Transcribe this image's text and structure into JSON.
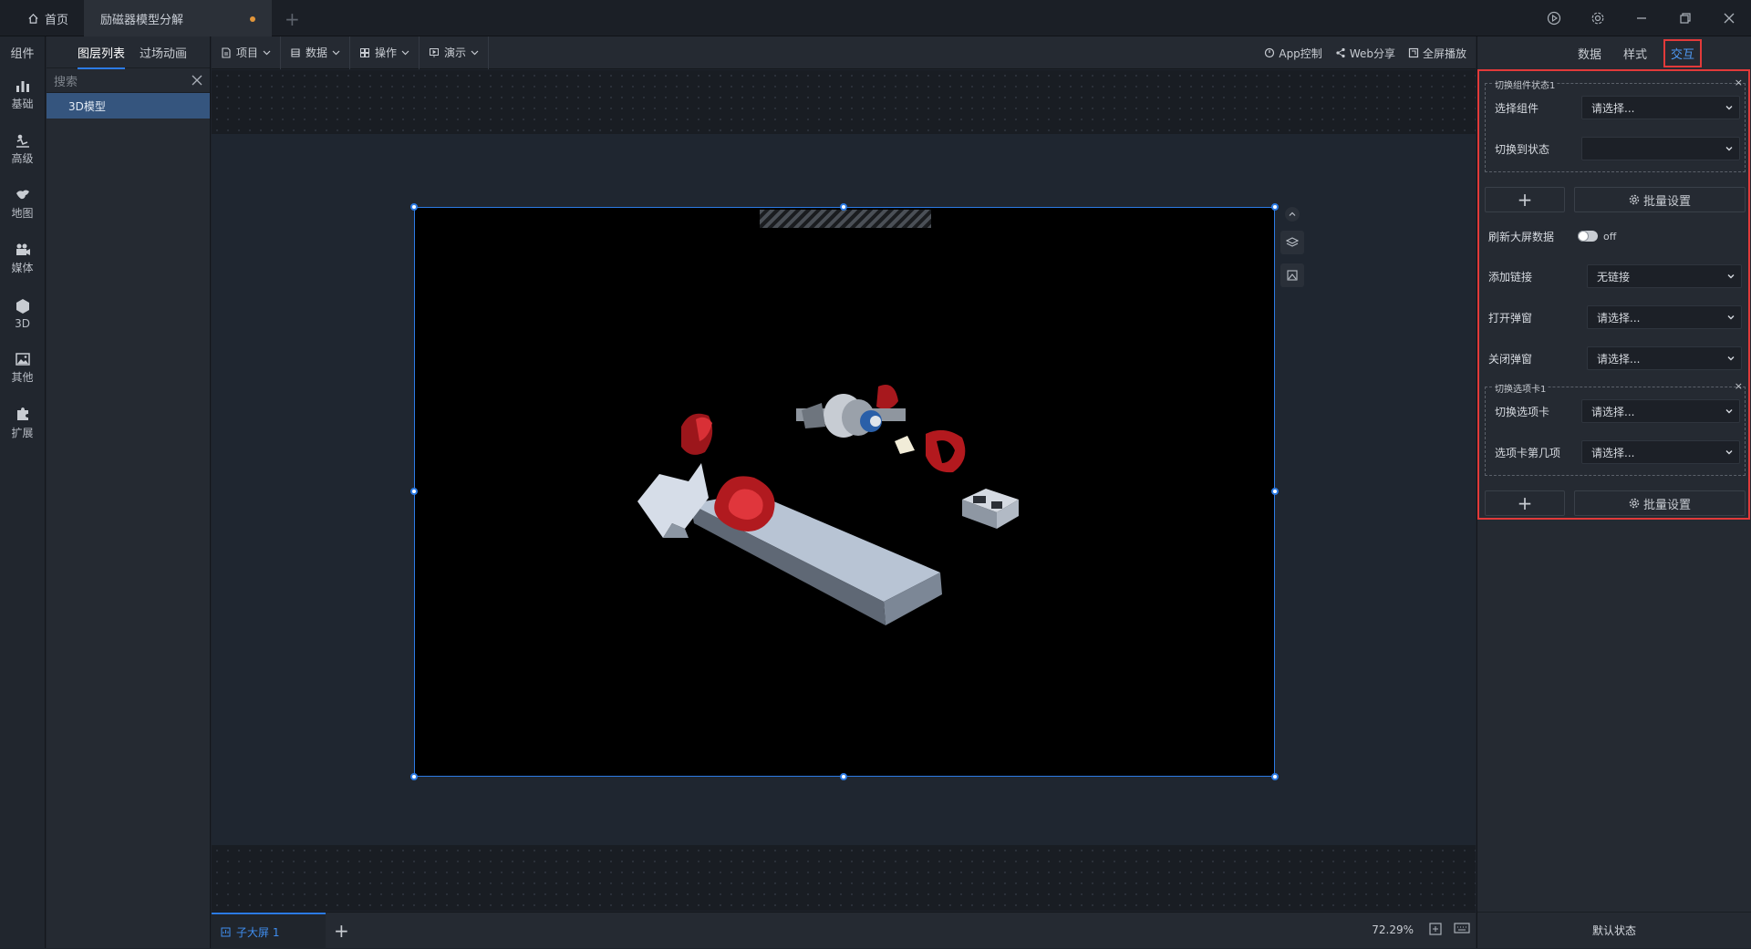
{
  "titlebar": {
    "home_tab": "首页",
    "doc_tab": "励磁器模型分解",
    "add_tab": "+"
  },
  "rail": {
    "header": "组件",
    "items": [
      {
        "label": "基础",
        "icon": "bar-chart-icon"
      },
      {
        "label": "高级",
        "icon": "advanced-icon"
      },
      {
        "label": "地图",
        "icon": "map-icon"
      },
      {
        "label": "媒体",
        "icon": "media-icon"
      },
      {
        "label": "3D",
        "icon": "cube-icon"
      },
      {
        "label": "其他",
        "icon": "image-icon"
      },
      {
        "label": "扩展",
        "icon": "puzzle-icon"
      }
    ]
  },
  "layers": {
    "tab_layers": "图层列表",
    "tab_transition": "过场动画",
    "search_placeholder": "搜索",
    "items": [
      "3D模型"
    ]
  },
  "toolbar": {
    "project": "项目",
    "data": "数据",
    "operate": "操作",
    "demo": "演示",
    "app_control": "App控制",
    "web_share": "Web分享",
    "fullscreen": "全屏播放"
  },
  "bottom": {
    "sub_screen": "子大屏 1",
    "add": "+",
    "zoom": "72.29%"
  },
  "rpanel": {
    "tabs": [
      "数据",
      "样式",
      "交互"
    ],
    "selected_tab": "交互",
    "group1": {
      "title": "切换组件状态1",
      "select_component_label": "选择组件",
      "select_component_value": "请选择...",
      "switch_state_label": "切换到状态",
      "switch_state_value": ""
    },
    "add_button": "+",
    "batch_label": "批量设置",
    "refresh_label": "刷新大屏数据",
    "refresh_value": "off",
    "add_link_label": "添加链接",
    "add_link_value": "无链接",
    "open_popup_label": "打开弹窗",
    "open_popup_value": "请选择...",
    "close_popup_label": "关闭弹窗",
    "close_popup_value": "请选择...",
    "group2": {
      "title": "切换选项卡1",
      "switch_tab_label": "切换选项卡",
      "switch_tab_value": "请选择...",
      "tab_index_label": "选项卡第几项",
      "tab_index_value": "请选择..."
    },
    "footer": "默认状态"
  }
}
